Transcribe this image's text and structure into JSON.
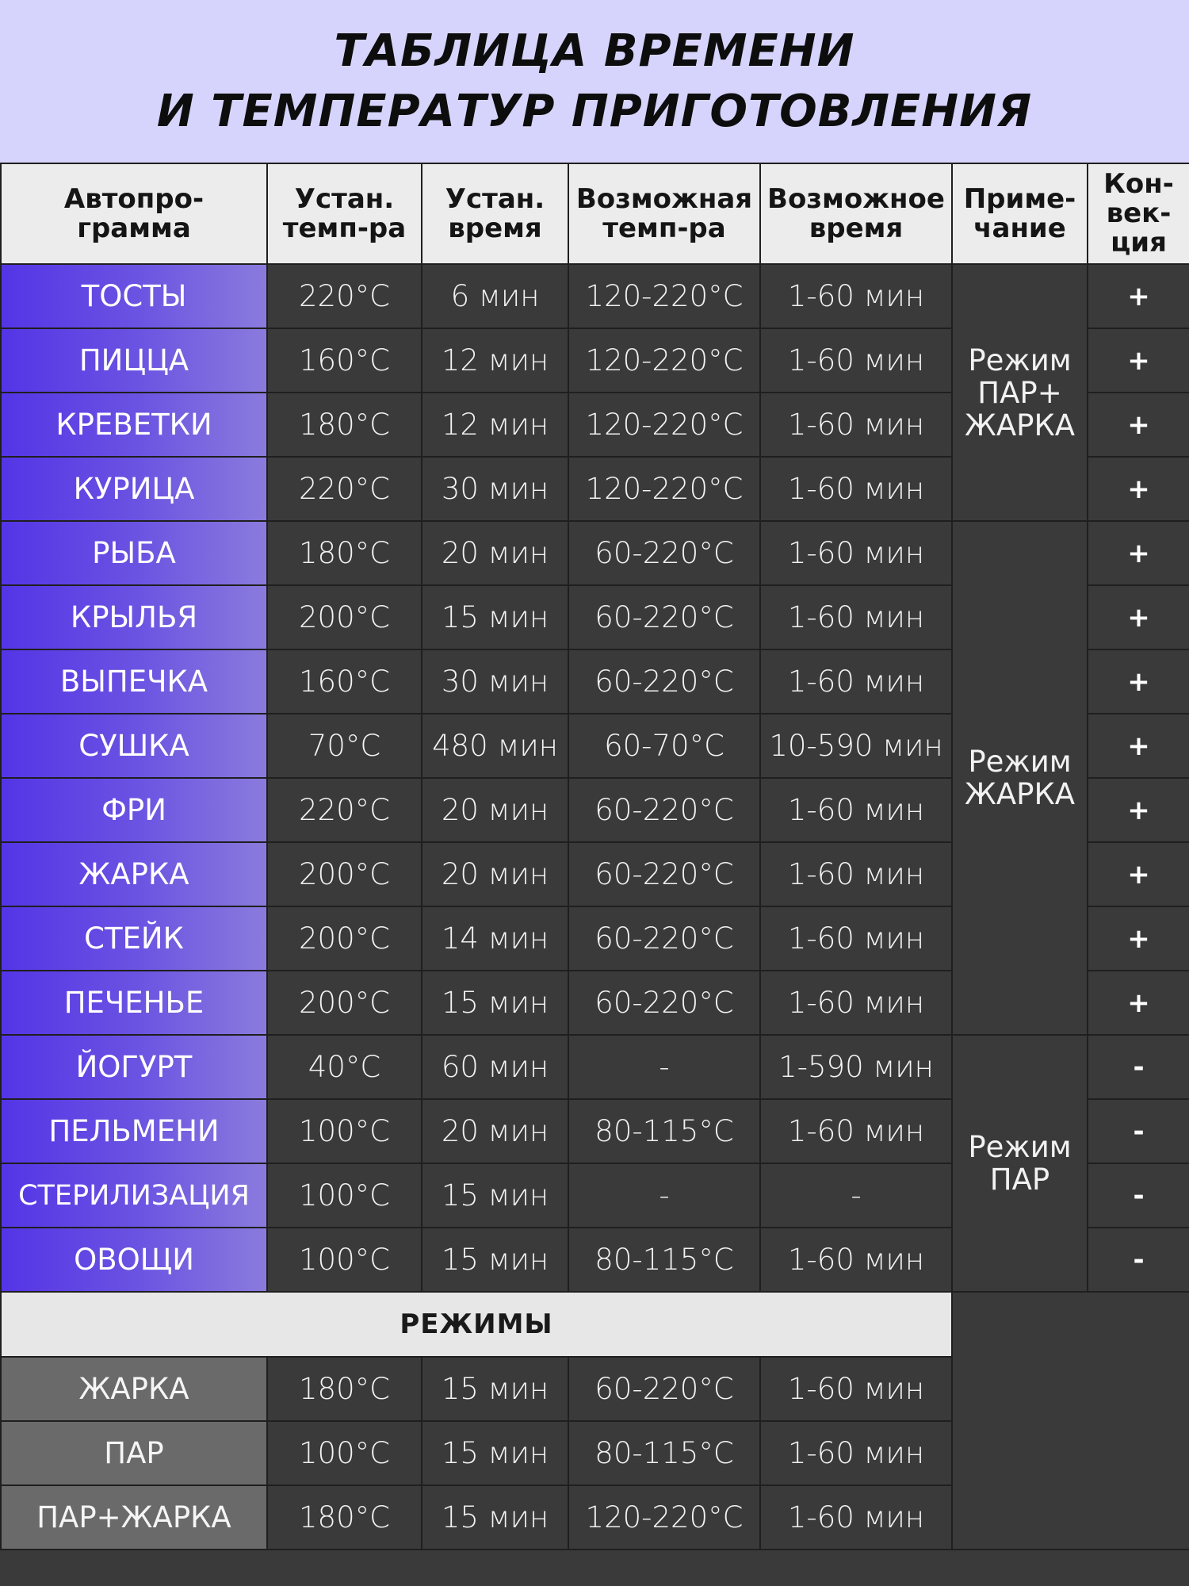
{
  "title": {
    "line1": "ТАБЛИЦА ВРЕМЕНИ",
    "line2": "И ТЕМПЕРАТУР ПРИГОТОВЛЕНИЯ"
  },
  "headers": {
    "program": [
      "Автопро-",
      "грамма"
    ],
    "set_temp": [
      "Устан.",
      "темп-ра"
    ],
    "set_time": [
      "Устан.",
      "время"
    ],
    "possible_temp": [
      "Возможная",
      "темп-ра"
    ],
    "possible_time": [
      "Возможное",
      "время"
    ],
    "note": [
      "Приме-",
      "чание"
    ],
    "convection": [
      "Кон-",
      "век-",
      "ция"
    ]
  },
  "programs": [
    {
      "name": "ТОСТЫ",
      "set_temp": "220°C",
      "set_time": "6 мин",
      "temp_range": "120-220°C",
      "time_range": "1-60 мин",
      "convection": "+"
    },
    {
      "name": "ПИЦЦА",
      "set_temp": "160°C",
      "set_time": "12 мин",
      "temp_range": "120-220°C",
      "time_range": "1-60 мин",
      "convection": "+"
    },
    {
      "name": "КРЕВЕТКИ",
      "set_temp": "180°C",
      "set_time": "12 мин",
      "temp_range": "120-220°C",
      "time_range": "1-60 мин",
      "convection": "+"
    },
    {
      "name": "КУРИЦА",
      "set_temp": "220°C",
      "set_time": "30 мин",
      "temp_range": "120-220°C",
      "time_range": "1-60 мин",
      "convection": "+"
    },
    {
      "name": "РЫБА",
      "set_temp": "180°C",
      "set_time": "20 мин",
      "temp_range": "60-220°C",
      "time_range": "1-60 мин",
      "convection": "+"
    },
    {
      "name": "КРЫЛЬЯ",
      "set_temp": "200°C",
      "set_time": "15 мин",
      "temp_range": "60-220°C",
      "time_range": "1-60 мин",
      "convection": "+"
    },
    {
      "name": "ВЫПЕЧКА",
      "set_temp": "160°C",
      "set_time": "30 мин",
      "temp_range": "60-220°C",
      "time_range": "1-60 мин",
      "convection": "+"
    },
    {
      "name": "СУШКА",
      "set_temp": "70°C",
      "set_time": "480 мин",
      "temp_range": "60-70°C",
      "time_range": "10-590 мин",
      "convection": "+"
    },
    {
      "name": "ФРИ",
      "set_temp": "220°C",
      "set_time": "20 мин",
      "temp_range": "60-220°C",
      "time_range": "1-60 мин",
      "convection": "+"
    },
    {
      "name": "ЖАРКА",
      "set_temp": "200°C",
      "set_time": "20 мин",
      "temp_range": "60-220°C",
      "time_range": "1-60 мин",
      "convection": "+"
    },
    {
      "name": "СТЕЙК",
      "set_temp": "200°C",
      "set_time": "14 мин",
      "temp_range": "60-220°C",
      "time_range": "1-60 мин",
      "convection": "+"
    },
    {
      "name": "ПЕЧЕНЬЕ",
      "set_temp": "200°C",
      "set_time": "15 мин",
      "temp_range": "60-220°C",
      "time_range": "1-60 мин",
      "convection": "+"
    },
    {
      "name": "ЙОГУРТ",
      "set_temp": "40°C",
      "set_time": "60 мин",
      "temp_range": "-",
      "time_range": "1-590 мин",
      "convection": "-"
    },
    {
      "name": "ПЕЛЬМЕНИ",
      "set_temp": "100°C",
      "set_time": "20 мин",
      "temp_range": "80-115°C",
      "time_range": "1-60 мин",
      "convection": "-"
    },
    {
      "name": "СТЕРИЛИЗАЦИЯ",
      "set_temp": "100°C",
      "set_time": "15 мин",
      "temp_range": "-",
      "time_range": "-",
      "convection": "-"
    },
    {
      "name": "ОВОЩИ",
      "set_temp": "100°C",
      "set_time": "15 мин",
      "temp_range": "80-115°C",
      "time_range": "1-60 мин",
      "convection": "-"
    }
  ],
  "notes": {
    "steam_fry": [
      "Режим",
      "ПАР+",
      "ЖАРКА"
    ],
    "fry": [
      "Режим",
      "ЖАРКА"
    ],
    "steam": [
      "Режим",
      "ПАР"
    ]
  },
  "modes_title": "РЕЖИМЫ",
  "modes": [
    {
      "name": "ЖАРКА",
      "set_temp": "180°C",
      "set_time": "15 мин",
      "temp_range": "60-220°C",
      "time_range": "1-60 мин"
    },
    {
      "name": "ПАР",
      "set_temp": "100°C",
      "set_time": "15 мин",
      "temp_range": "80-115°C",
      "time_range": "1-60 мин"
    },
    {
      "name": "ПАР+ЖАРКА",
      "set_temp": "180°C",
      "set_time": "15 мин",
      "temp_range": "120-220°C",
      "time_range": "1-60 мин"
    }
  ],
  "colors": {
    "title_band": "#d6d4fc",
    "program_gradient_start": "#5435e6",
    "program_gradient_end": "#8a7bdd",
    "cell_background": "#3a3a3a",
    "mode_name_background": "#6a6a6a",
    "header_background": "#ececec"
  }
}
